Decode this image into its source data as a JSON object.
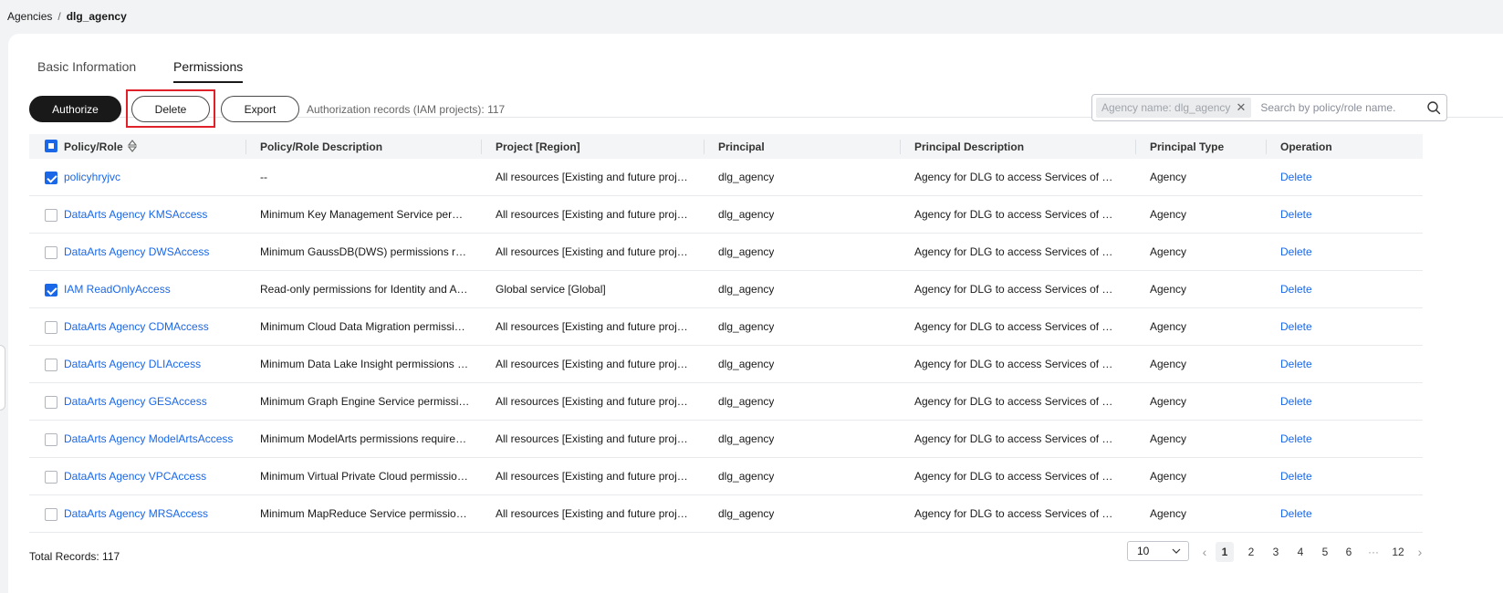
{
  "breadcrumb": {
    "parent": "Agencies",
    "separator": "/",
    "current": "dlg_agency"
  },
  "tabs": [
    {
      "label": "Basic Information",
      "active": false
    },
    {
      "label": "Permissions",
      "active": true
    }
  ],
  "toolbar": {
    "authorize_label": "Authorize",
    "delete_label": "Delete",
    "export_label": "Export",
    "records_text": "Authorization records (IAM projects): 117"
  },
  "search": {
    "chip_label": "Agency name: dlg_agency",
    "placeholder": "Search by policy/role name."
  },
  "table": {
    "headers": {
      "policy": "Policy/Role",
      "description": "Policy/Role Description",
      "project": "Project [Region]",
      "principal": "Principal",
      "principal_desc": "Principal Description",
      "principal_type": "Principal Type",
      "operation": "Operation"
    },
    "rows": [
      {
        "checked": true,
        "policy": "policyhryjvc",
        "description": "--",
        "project": "All resources [Existing and future projec...",
        "principal": "dlg_agency",
        "principal_desc": "Agency for DLG to access Services of OB...",
        "principal_type": "Agency",
        "operation": "Delete"
      },
      {
        "checked": false,
        "policy": "DataArts Agency KMSAccess",
        "description": "Minimum Key Management Service permi...",
        "project": "All resources [Existing and future projec...",
        "principal": "dlg_agency",
        "principal_desc": "Agency for DLG to access Services of OB...",
        "principal_type": "Agency",
        "operation": "Delete"
      },
      {
        "checked": false,
        "policy": "DataArts Agency DWSAccess",
        "description": "Minimum GaussDB(DWS) permissions re...",
        "project": "All resources [Existing and future projec...",
        "principal": "dlg_agency",
        "principal_desc": "Agency for DLG to access Services of OB...",
        "principal_type": "Agency",
        "operation": "Delete"
      },
      {
        "checked": true,
        "policy": "IAM ReadOnlyAccess",
        "description": "Read-only permissions for Identity and Ac...",
        "project": "Global service [Global]",
        "principal": "dlg_agency",
        "principal_desc": "Agency for DLG to access Services of OB...",
        "principal_type": "Agency",
        "operation": "Delete"
      },
      {
        "checked": false,
        "policy": "DataArts Agency CDMAccess",
        "description": "Minimum Cloud Data Migration permission...",
        "project": "All resources [Existing and future projec...",
        "principal": "dlg_agency",
        "principal_desc": "Agency for DLG to access Services of OB...",
        "principal_type": "Agency",
        "operation": "Delete"
      },
      {
        "checked": false,
        "policy": "DataArts Agency DLIAccess",
        "description": "Minimum Data Lake Insight permissions re...",
        "project": "All resources [Existing and future projec...",
        "principal": "dlg_agency",
        "principal_desc": "Agency for DLG to access Services of OB...",
        "principal_type": "Agency",
        "operation": "Delete"
      },
      {
        "checked": false,
        "policy": "DataArts Agency GESAccess",
        "description": "Minimum Graph Engine Service permissio...",
        "project": "All resources [Existing and future projec...",
        "principal": "dlg_agency",
        "principal_desc": "Agency for DLG to access Services of OB...",
        "principal_type": "Agency",
        "operation": "Delete"
      },
      {
        "checked": false,
        "policy": "DataArts Agency ModelArtsAccess",
        "description": "Minimum ModelArts permissions required ...",
        "project": "All resources [Existing and future projec...",
        "principal": "dlg_agency",
        "principal_desc": "Agency for DLG to access Services of OB...",
        "principal_type": "Agency",
        "operation": "Delete"
      },
      {
        "checked": false,
        "policy": "DataArts Agency VPCAccess",
        "description": "Minimum Virtual Private Cloud permission...",
        "project": "All resources [Existing and future projec...",
        "principal": "dlg_agency",
        "principal_desc": "Agency for DLG to access Services of OB...",
        "principal_type": "Agency",
        "operation": "Delete"
      },
      {
        "checked": false,
        "policy": "DataArts Agency MRSAccess",
        "description": "Minimum MapReduce Service permission...",
        "project": "All resources [Existing and future projec...",
        "principal": "dlg_agency",
        "principal_desc": "Agency for DLG to access Services of OB...",
        "principal_type": "Agency",
        "operation": "Delete"
      }
    ]
  },
  "footer": {
    "total_text": "Total Records: 117",
    "page_size": "10",
    "pages": [
      "1",
      "2",
      "3",
      "4",
      "5",
      "6",
      "···",
      "12"
    ],
    "current_page": "1"
  },
  "colors": {
    "accent": "#1a67e8",
    "primary_button": "#191919",
    "highlight_box": "#e0212a"
  }
}
